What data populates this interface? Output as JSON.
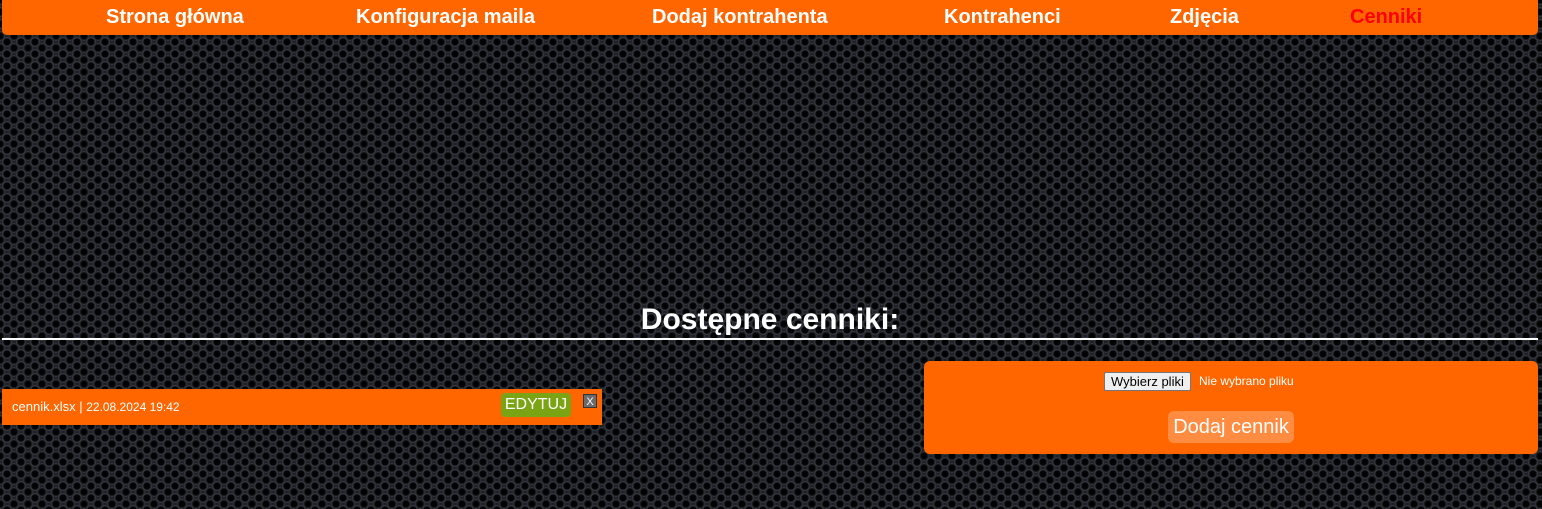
{
  "nav": {
    "items": [
      {
        "label": "Strona główna"
      },
      {
        "label": "Konfiguracja maila"
      },
      {
        "label": "Dodaj kontrahenta"
      },
      {
        "label": "Kontrahenci"
      },
      {
        "label": "Zdjęcia"
      },
      {
        "label": "Cenniki",
        "active": true
      }
    ]
  },
  "main": {
    "title": "Dostępne cenniki:",
    "files": [
      {
        "name": "cennik.xlsx",
        "separator": " | ",
        "date": "22.08.2024 19:42",
        "edit_label": "EDYTUJ",
        "delete_label": "X"
      }
    ]
  },
  "upload": {
    "choose_label": "Wybierz pliki",
    "no_file_text": "Nie wybrano pliku",
    "submit_label": "Dodaj cennik"
  },
  "colors": {
    "accent": "#ff6600",
    "active_nav": "#ff0000",
    "edit_button": "#7aa414"
  }
}
